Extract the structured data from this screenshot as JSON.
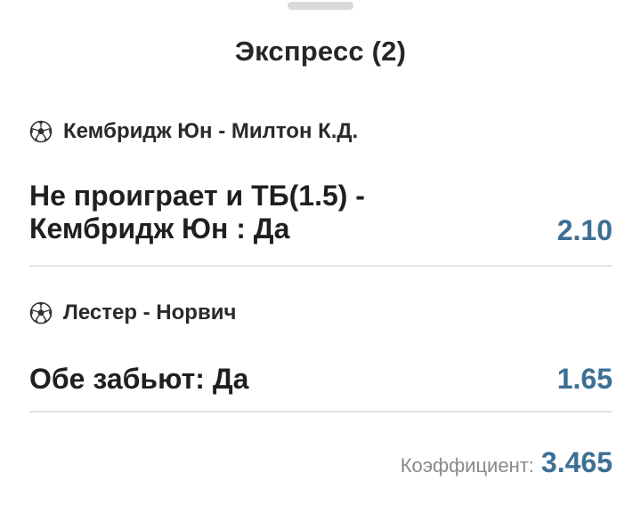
{
  "title": "Экспресс (2)",
  "bets": [
    {
      "event": "Кембридж Юн - Милтон К.Д.",
      "outcome_line1": "Не проиграет и ТБ(1.5) -",
      "outcome_line2": "Кембридж Юн : Да",
      "odds": "2.10",
      "icon": "soccer-ball-icon"
    },
    {
      "event": "Лестер - Норвич",
      "outcome_line1": "Обе забьют: Да",
      "odds": "1.65",
      "icon": "soccer-ball-icon"
    }
  ],
  "total": {
    "label": "Коэффициент:",
    "value": "3.465"
  },
  "colors": {
    "odds": "#3c6f93",
    "label_gray": "#8a8a8a",
    "divider": "#e3e3e3"
  }
}
